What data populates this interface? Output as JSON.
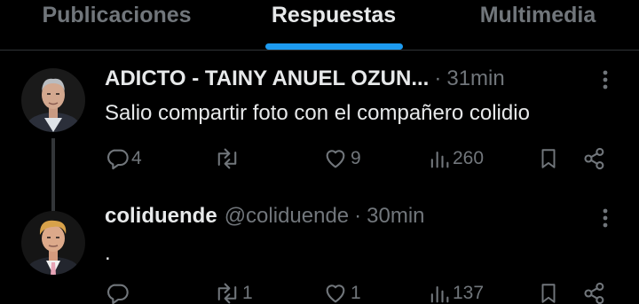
{
  "tabs": [
    {
      "label": "Publicaciones",
      "active": false
    },
    {
      "label": "Respuestas",
      "active": true
    },
    {
      "label": "Multimedia",
      "active": false
    }
  ],
  "accent_color": "#1d9bf0",
  "posts": [
    {
      "display_name": "ADICTO - TAINY ANUEL OZUN...",
      "handle": "",
      "separator": "·",
      "time": "31min",
      "text": "Salio compartir foto con el compañero colidio",
      "replies": "4",
      "retweets": "",
      "likes": "9",
      "views": "260"
    },
    {
      "display_name": "coliduende",
      "handle": "@coliduende",
      "separator": "·",
      "time": "30min",
      "text": ".",
      "replies": "",
      "retweets": "1",
      "likes": "1",
      "views": "137"
    }
  ]
}
